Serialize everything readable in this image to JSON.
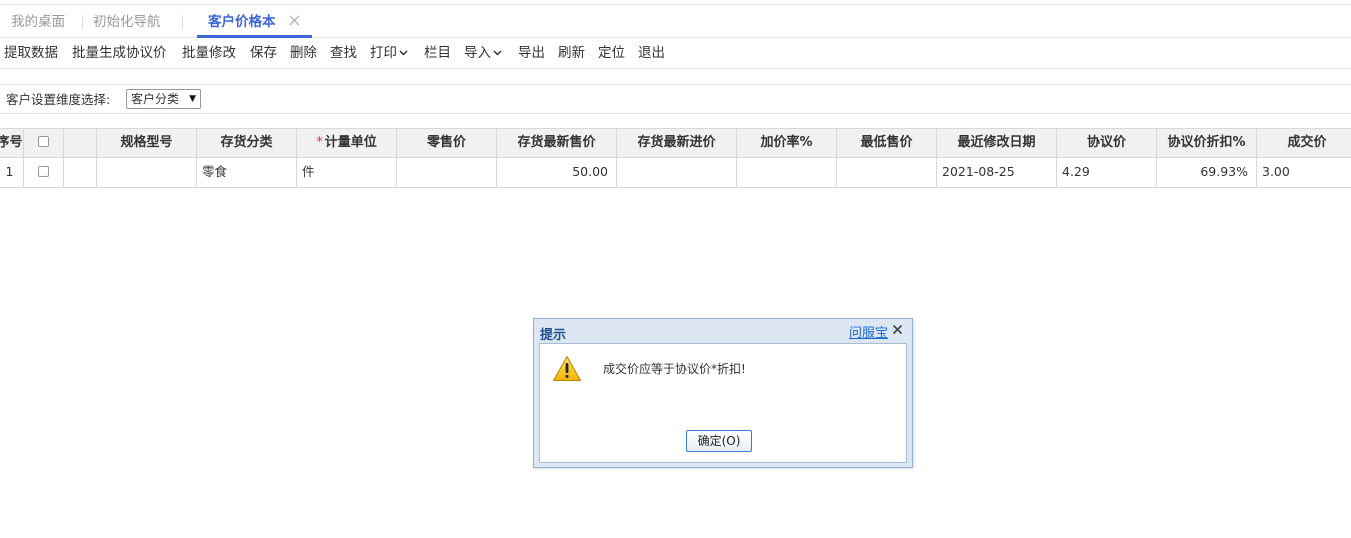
{
  "tabs": [
    {
      "label": "我的桌面",
      "active": false
    },
    {
      "label": "初始化导航",
      "active": false
    },
    {
      "label": "客户价格本",
      "active": true
    }
  ],
  "toolbar": {
    "buttons": [
      {
        "label": "提取数据"
      },
      {
        "label": "批量生成协议价"
      },
      {
        "label": "批量修改"
      },
      {
        "label": "保存"
      },
      {
        "label": "删除"
      },
      {
        "label": "查找"
      },
      {
        "label": "打印",
        "dropdown": true
      },
      {
        "label": "栏目"
      },
      {
        "label": "导入",
        "dropdown": true
      },
      {
        "label": "导出"
      },
      {
        "label": "刷新"
      },
      {
        "label": "定位"
      },
      {
        "label": "退出"
      }
    ]
  },
  "filter": {
    "label": "客户设置维度选择:",
    "selected": "客户分类"
  },
  "grid": {
    "columns": [
      {
        "key": "seq",
        "label": "序号"
      },
      {
        "key": "check",
        "label": ""
      },
      {
        "key": "blank",
        "label": ""
      },
      {
        "key": "spec",
        "label": "规格型号"
      },
      {
        "key": "category",
        "label": "存货分类"
      },
      {
        "key": "unit",
        "label": "计量单位",
        "required": true
      },
      {
        "key": "retail",
        "label": "零售价"
      },
      {
        "key": "latest_sale",
        "label": "存货最新售价"
      },
      {
        "key": "latest_purchase",
        "label": "存货最新进价"
      },
      {
        "key": "markup",
        "label": "加价率%"
      },
      {
        "key": "min_price",
        "label": "最低售价"
      },
      {
        "key": "modified",
        "label": "最近修改日期"
      },
      {
        "key": "agreed",
        "label": "协议价"
      },
      {
        "key": "discount",
        "label": "协议价折扣%"
      },
      {
        "key": "deal",
        "label": "成交价"
      }
    ],
    "rows": [
      {
        "seq": "1",
        "spec": "",
        "category": "零食",
        "unit": "件",
        "retail": "",
        "latest_sale": "50.00",
        "latest_purchase": "",
        "markup": "",
        "min_price": "",
        "modified": "2021-08-25",
        "agreed": "4.29",
        "discount": "69.93%",
        "deal": "3.00"
      }
    ]
  },
  "dialog": {
    "title": "提示",
    "help_link": "问服宝",
    "message": "成交价应等于协议价*折扣!",
    "ok_label": "确定(O)",
    "icon": "warning-icon"
  },
  "colors": {
    "accent": "#3b66d5",
    "required": "#e0383a",
    "dialog_frame": "#dde7f3",
    "link": "#1967d2"
  }
}
